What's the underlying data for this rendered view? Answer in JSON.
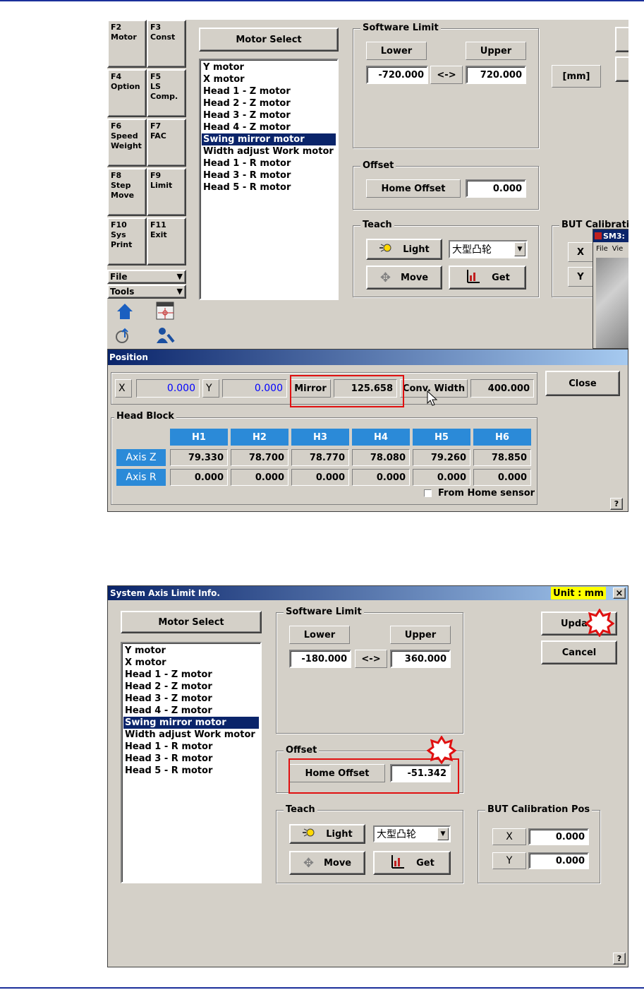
{
  "top": {
    "fkeys": [
      {
        "label": "F2\nMotor"
      },
      {
        "label": "F3\nConst"
      },
      {
        "label": "F4\nOption"
      },
      {
        "label": "F5\nLS\nComp."
      },
      {
        "label": "F6\nSpeed\nWeight"
      },
      {
        "label": "F7\nFAC"
      },
      {
        "label": "F8\nStep\nMove"
      },
      {
        "label": "F9\nLimit"
      },
      {
        "label": "F10\nSys\nPrint"
      },
      {
        "label": "F11\nExit"
      }
    ],
    "file_menu": "File",
    "tools_menu": "Tools",
    "motor_select": "Motor Select",
    "motors": [
      "Y motor",
      "X motor",
      "Head 1 - Z motor",
      "Head 2 - Z motor",
      "Head 3 - Z motor",
      "Head 4 - Z motor",
      "Swing mirror motor",
      "Width adjust Work motor",
      "Head 1 - R motor",
      "Head 3 - R motor",
      "Head 5 - R motor"
    ],
    "selected_motor": "Swing mirror motor",
    "software_limit": {
      "title": "Software Limit",
      "lower_label": "Lower",
      "upper_label": "Upper",
      "lower": "-720.000",
      "sep": "<->",
      "upper": "720.000",
      "unit": "[mm]"
    },
    "offset": {
      "title": "Offset",
      "home_offset_label": "Home Offset",
      "home_offset": "0.000"
    },
    "teach": {
      "title": "Teach",
      "light": "Light",
      "combo": "大型凸轮",
      "move": "Move",
      "get": "Get"
    },
    "but_title": "BUT Calibrati",
    "but_x": "X",
    "but_y": "Y",
    "sm_title": "SM3:",
    "sm_file": "File",
    "sm_view": "Vie",
    "position": {
      "title": "Position",
      "x_label": "X",
      "x": "0.000",
      "y_label": "Y",
      "y": "0.000",
      "mirror_label": "Mirror",
      "mirror": "125.658",
      "conv_label": "Conv. Width",
      "conv": "400.000",
      "close": "Close",
      "head_block": "Head Block",
      "heads": [
        "H1",
        "H2",
        "H3",
        "H4",
        "H5",
        "H6"
      ],
      "axis_z_label": "Axis Z",
      "axis_z": [
        "79.330",
        "78.700",
        "78.770",
        "78.080",
        "79.260",
        "78.850"
      ],
      "axis_r_label": "Axis R",
      "axis_r": [
        "0.000",
        "0.000",
        "0.000",
        "0.000",
        "0.000",
        "0.000"
      ],
      "from_home": "From Home sensor",
      "help": "?"
    }
  },
  "bottom": {
    "title": "System Axis Limit Info.",
    "unit": "Unit : mm",
    "close": "×",
    "motor_select": "Motor Select",
    "motors": [
      "Y motor",
      "X motor",
      "Head 1 - Z motor",
      "Head 2 - Z motor",
      "Head 3 - Z motor",
      "Head 4 - Z motor",
      "Swing mirror motor",
      "Width adjust Work motor",
      "Head 1 - R motor",
      "Head 3 - R motor",
      "Head 5 - R motor"
    ],
    "software_limit": {
      "title": "Software Limit",
      "lower_label": "Lower",
      "upper_label": "Upper",
      "lower": "-180.000",
      "sep": "<->",
      "upper": "360.000"
    },
    "offset": {
      "title": "Offset",
      "home_offset_label": "Home Offset",
      "home_offset": "-51.342"
    },
    "teach": {
      "title": "Teach",
      "light": "Light",
      "combo": "大型凸轮",
      "move": "Move",
      "get": "Get"
    },
    "but": {
      "title": "BUT Calibration Pos",
      "x_label": "X",
      "x": "0.000",
      "y_label": "Y",
      "y": "0.000"
    },
    "update": "Upda",
    "cancel": "Cancel",
    "help": "?"
  },
  "colors": {
    "accent_blue": "#0a246a",
    "header_blue": "#2b8ad8",
    "highlight_red": "#e01010",
    "unit_yellow": "#ffff00",
    "value_blue": "#0000ff"
  }
}
